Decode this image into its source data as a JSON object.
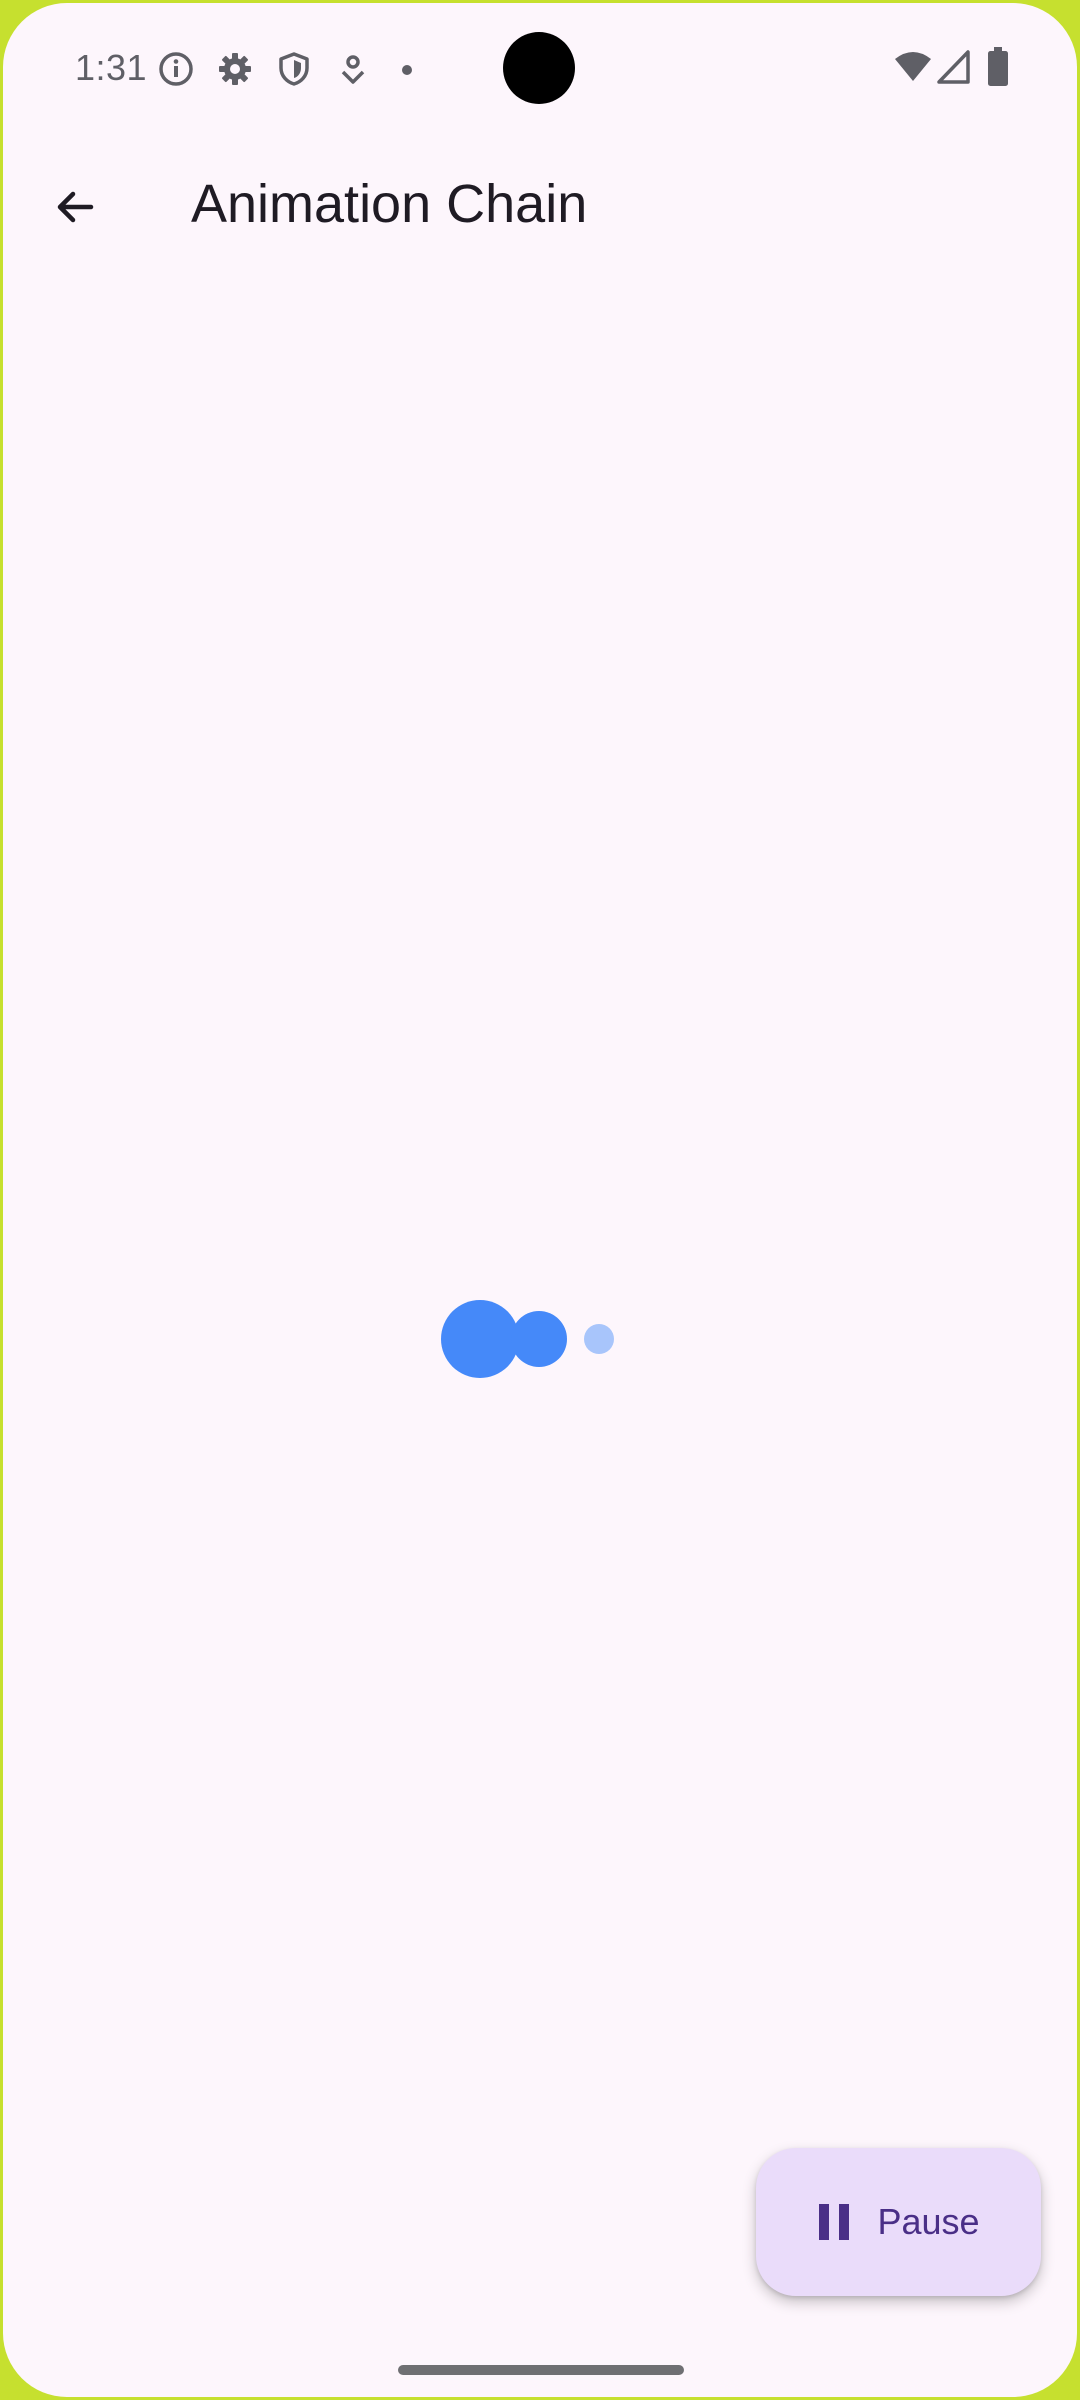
{
  "status_bar": {
    "time": "1:31",
    "left_icons": [
      "info-icon",
      "settings-icon",
      "shield-icon",
      "location-icon",
      "dot-icon"
    ],
    "right_icons": [
      "wifi-icon",
      "signal-icon",
      "battery-icon"
    ]
  },
  "app_bar": {
    "title": "Animation Chain",
    "back_icon": "arrow-back-icon"
  },
  "loader": {
    "dot_color": "#4589f9",
    "faded_color": "#a8c5fb"
  },
  "fab": {
    "label": "Pause",
    "icon": "pause-icon",
    "background": "#eadcfa",
    "text_color": "#4a2f87"
  },
  "colors": {
    "background": "#fdf6fc",
    "frame": "#c6e02f"
  }
}
